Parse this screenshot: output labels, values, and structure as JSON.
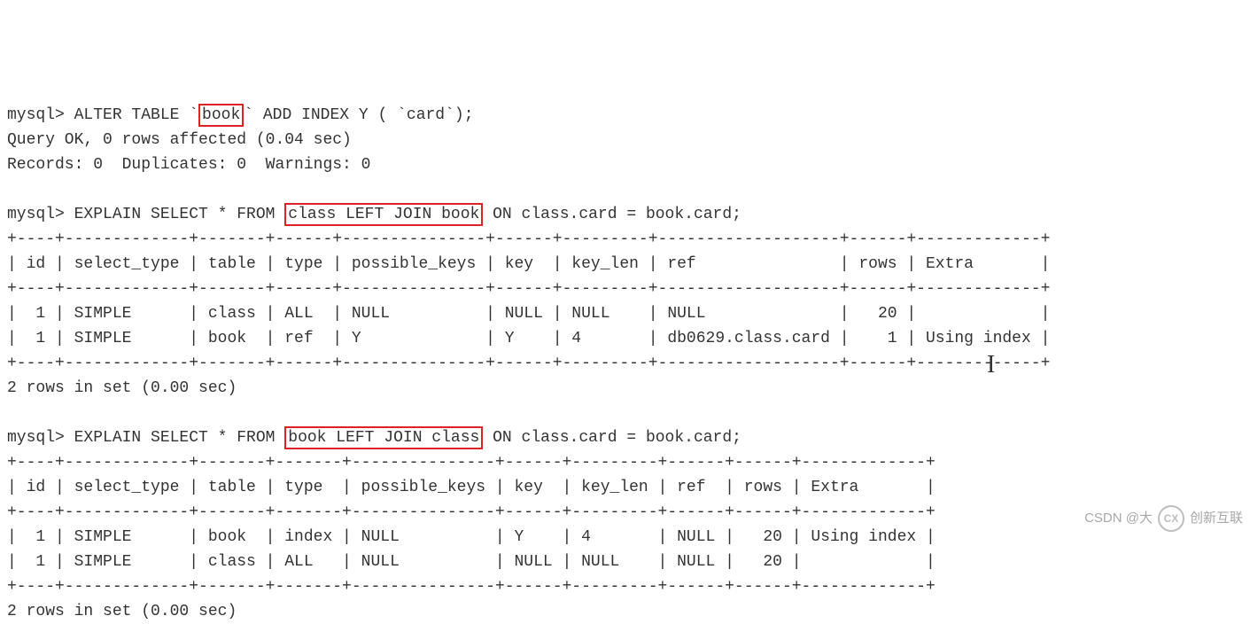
{
  "prompt": "mysql>",
  "cmd1": {
    "pre": " ALTER TABLE `",
    "box": "book",
    "post": "` ADD INDEX Y ( `card`);"
  },
  "res1a": "Query OK, 0 rows affected (0.04 sec)",
  "res1b": "Records: 0  Duplicates: 0  Warnings: 0",
  "cmd2": {
    "pre": " EXPLAIN SELECT * FROM ",
    "box": "class LEFT JOIN book",
    "post": " ON class.card = book.card;"
  },
  "tbl1": {
    "border": "+----+-------------+-------+------+---------------+------+---------+-------------------+------+-------------+",
    "header": "| id | select_type | table | type | possible_keys | key  | key_len | ref               | rows | Extra       |",
    "row1": "|  1 | SIMPLE      | class | ALL  | NULL          | NULL | NULL    | NULL              |   20 |             |",
    "row2": "|  1 | SIMPLE      | book  | ref  | Y             | Y    | 4       | db0629.class.card |    1 | Using index |"
  },
  "res2": "2 rows in set (0.00 sec)",
  "cmd3": {
    "pre": " EXPLAIN SELECT * FROM ",
    "box": "book LEFT JOIN class",
    "post": " ON class.card = book.card;"
  },
  "tbl2": {
    "border": "+----+-------------+-------+-------+---------------+------+---------+------+------+-------------+",
    "header": "| id | select_type | table | type  | possible_keys | key  | key_len | ref  | rows | Extra       |",
    "row1": "|  1 | SIMPLE      | book  | index | NULL          | Y    | 4       | NULL |   20 | Using index |",
    "row2": "|  1 | SIMPLE      | class | ALL   | NULL          | NULL | NULL    | NULL |   20 |             |"
  },
  "res3": "2 rows in set (0.00 sec)",
  "watermark": {
    "csdn": "CSDN @大",
    "brand": "创新互联",
    "logo": "CX"
  },
  "chart_data": {
    "type": "table",
    "note": "MySQL EXPLAIN output comparing index usage when join order is swapped",
    "tables": [
      {
        "query": "EXPLAIN SELECT * FROM class LEFT JOIN book ON class.card = book.card",
        "columns": [
          "id",
          "select_type",
          "table",
          "type",
          "possible_keys",
          "key",
          "key_len",
          "ref",
          "rows",
          "Extra"
        ],
        "rows": [
          [
            1,
            "SIMPLE",
            "class",
            "ALL",
            "NULL",
            "NULL",
            "NULL",
            "NULL",
            20,
            ""
          ],
          [
            1,
            "SIMPLE",
            "book",
            "ref",
            "Y",
            "Y",
            4,
            "db0629.class.card",
            1,
            "Using index"
          ]
        ]
      },
      {
        "query": "EXPLAIN SELECT * FROM book LEFT JOIN class ON class.card = book.card",
        "columns": [
          "id",
          "select_type",
          "table",
          "type",
          "possible_keys",
          "key",
          "key_len",
          "ref",
          "rows",
          "Extra"
        ],
        "rows": [
          [
            1,
            "SIMPLE",
            "book",
            "index",
            "NULL",
            "Y",
            4,
            "NULL",
            20,
            "Using index"
          ],
          [
            1,
            "SIMPLE",
            "class",
            "ALL",
            "NULL",
            "NULL",
            "NULL",
            "NULL",
            20,
            ""
          ]
        ]
      }
    ]
  }
}
